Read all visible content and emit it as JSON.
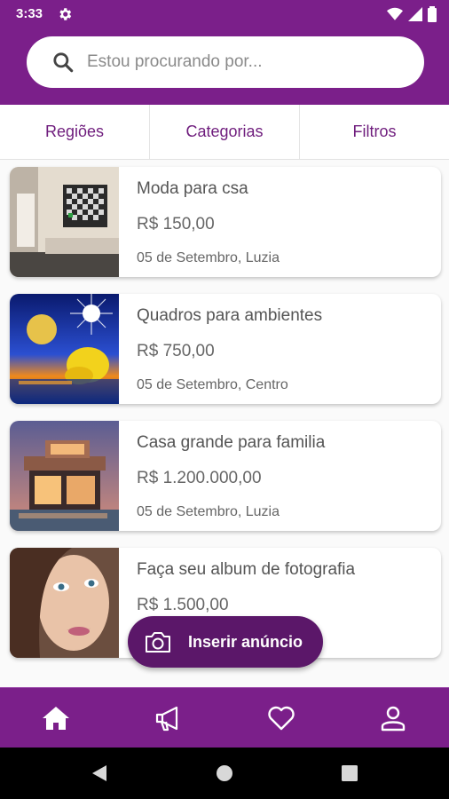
{
  "status_bar": {
    "time": "3:33"
  },
  "search": {
    "placeholder": "Estou procurando por..."
  },
  "tabs": [
    {
      "label": "Regiões"
    },
    {
      "label": "Categorias"
    },
    {
      "label": "Filtros"
    }
  ],
  "listings": [
    {
      "title": "Moda para csa",
      "price": "R$ 150,00",
      "meta": "05 de Setembro, Luzia"
    },
    {
      "title": "Quadros para ambientes",
      "price": "R$ 750,00",
      "meta": "05 de Setembro, Centro"
    },
    {
      "title": "Casa grande para familia",
      "price": "R$ 1.200.000,00",
      "meta": "05 de Setembro, Luzia"
    },
    {
      "title": "Faça seu album de fotografia",
      "price": "R$ 1.500,00",
      "meta": ""
    }
  ],
  "fab": {
    "label": "Inserir anúncio",
    "icon": "camera-icon"
  },
  "bottom_nav": [
    "home-icon",
    "megaphone-icon",
    "heart-icon",
    "user-icon"
  ],
  "colors": {
    "primary": "#7b1f8a",
    "fab": "#5b1769",
    "tab_text": "#6f1d7d"
  }
}
